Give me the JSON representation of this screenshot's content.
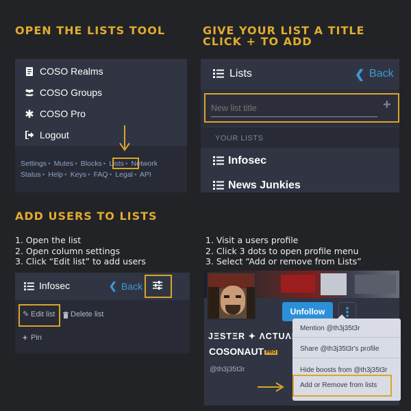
{
  "headings": {
    "h1": "OPEN THE LISTS TOOL",
    "h2_line1": "GIVE YOUR LIST A TITLE",
    "h2_line2": "CLICK + TO ADD",
    "h3": "ADD USERS TO LISTS"
  },
  "panel1": {
    "menu": [
      "COSO Realms",
      "COSO Groups",
      "COSO Pro",
      "Logout"
    ],
    "links_row1": [
      "Settings",
      "Mutes",
      "Blocks",
      "Lists",
      "Network"
    ],
    "links_row2": [
      "Status",
      "Help",
      "Keys",
      "FAQ",
      "Legal",
      "API"
    ]
  },
  "panel2": {
    "title": "Lists",
    "back": "Back",
    "placeholder": "New list title",
    "section": "YOUR LISTS",
    "lists": [
      "Infosec",
      "News Junkies"
    ]
  },
  "steps_left": [
    "1. Open the list",
    "2. Open column settings",
    "3. Click “Edit list” to add users"
  ],
  "panel3": {
    "title": "Infosec",
    "back": "Back",
    "edit": "Edit list",
    "delete": "Delete list",
    "pin": "Pin"
  },
  "steps_right": [
    "1. Visit a users profile",
    "2. Click 3 dots to open profile menu",
    "3. Select “Add or remove from Lists”"
  ],
  "panel4": {
    "unfollow": "Unfollow",
    "display_name": "JΞSTΞR ✦ ΛCTUΛL³",
    "org_name": "COSONAUT",
    "org_badge": "PRO",
    "handle": "@th3j35t3r",
    "menu": [
      "Mention @th3j35t3r",
      "Share @th3j35t3r's profile",
      "Hide boosts from @th3j35t3r",
      "Add or Remove from lists"
    ]
  },
  "colors": {
    "accent": "#e0ac2f",
    "link": "#3a9bdc",
    "panel": "#313543",
    "button": "#2b90d9"
  }
}
